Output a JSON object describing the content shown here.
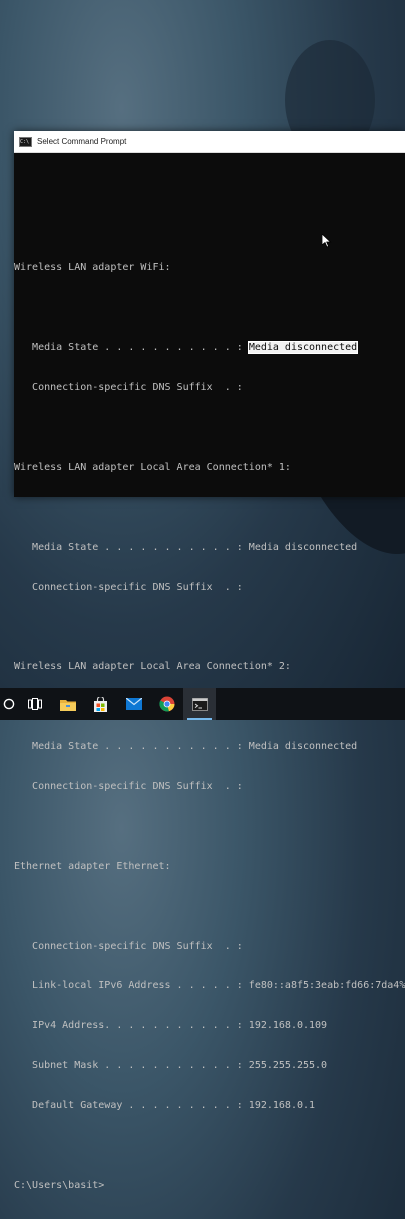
{
  "window": {
    "title": "Select Command Prompt"
  },
  "console_lines": [
    "",
    "",
    "Wireless LAN adapter WiFi:",
    "",
    "   Media State . . . . . . . . . . . : ",
    "   Connection-specific DNS Suffix  . :",
    "",
    "Wireless LAN adapter Local Area Connection* 1:",
    "",
    "   Media State . . . . . . . . . . . : Media disconnected",
    "   Connection-specific DNS Suffix  . :",
    "",
    "Wireless LAN adapter Local Area Connection* 2:",
    "",
    "   Media State . . . . . . . . . . . : Media disconnected",
    "   Connection-specific DNS Suffix  . :",
    "",
    "Ethernet adapter Ethernet:",
    "",
    "   Connection-specific DNS Suffix  . :",
    "   Link-local IPv6 Address . . . . . : fe80::a8f5:3eab:fd66:7da4%",
    "   IPv4 Address. . . . . . . . . . . : 192.168.0.109",
    "   Subnet Mask . . . . . . . . . . . : 255.255.255.0",
    "   Default Gateway . . . . . . . . . : 192.168.0.1",
    "",
    "C:\\Users\\basit>"
  ],
  "selected_text": "Media disconnected",
  "taskbar": {
    "items": [
      "cortana-icon",
      "task-view-icon",
      "file-explorer-icon",
      "store-icon",
      "mail-icon",
      "chrome-icon",
      "command-prompt-icon"
    ]
  }
}
